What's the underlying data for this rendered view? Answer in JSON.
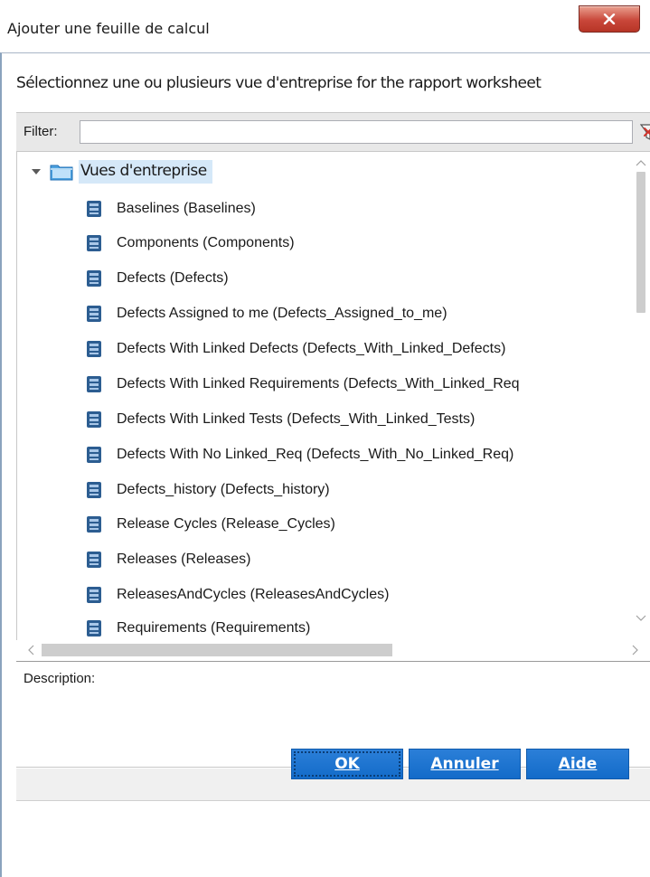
{
  "window": {
    "title": "Ajouter une feuille de calcul",
    "close_icon": "close-icon"
  },
  "header": {
    "instruction": "Sélectionnez une ou plusieurs vue d'entreprise for the rapport worksheet"
  },
  "filter": {
    "label": "Filter:",
    "value": "",
    "clear_icon": "filter-clear-icon"
  },
  "tree": {
    "root_label": "Vues d'entreprise",
    "items": [
      {
        "label": "Baselines (Baselines)"
      },
      {
        "label": "Components (Components)"
      },
      {
        "label": "Defects (Defects)"
      },
      {
        "label": "Defects Assigned to me (Defects_Assigned_to_me)"
      },
      {
        "label": "Defects With Linked Defects (Defects_With_Linked_Defects)"
      },
      {
        "label": "Defects With Linked Requirements (Defects_With_Linked_Req"
      },
      {
        "label": "Defects With Linked Tests (Defects_With_Linked_Tests)"
      },
      {
        "label": "Defects With No Linked_Req (Defects_With_No_Linked_Req)"
      },
      {
        "label": "Defects_history (Defects_history)"
      },
      {
        "label": "Release Cycles (Release_Cycles)"
      },
      {
        "label": "Releases (Releases)"
      },
      {
        "label": "ReleasesAndCycles (ReleasesAndCycles)"
      },
      {
        "label": "Requirements (Requirements)"
      }
    ]
  },
  "description": {
    "label": "Description:"
  },
  "buttons": {
    "ok": "OK",
    "cancel": "Annuler",
    "help": "Aide"
  },
  "colors": {
    "button_blue": "#1a74d2",
    "selection": "#d5e8f8",
    "close_red": "#c9473a"
  }
}
